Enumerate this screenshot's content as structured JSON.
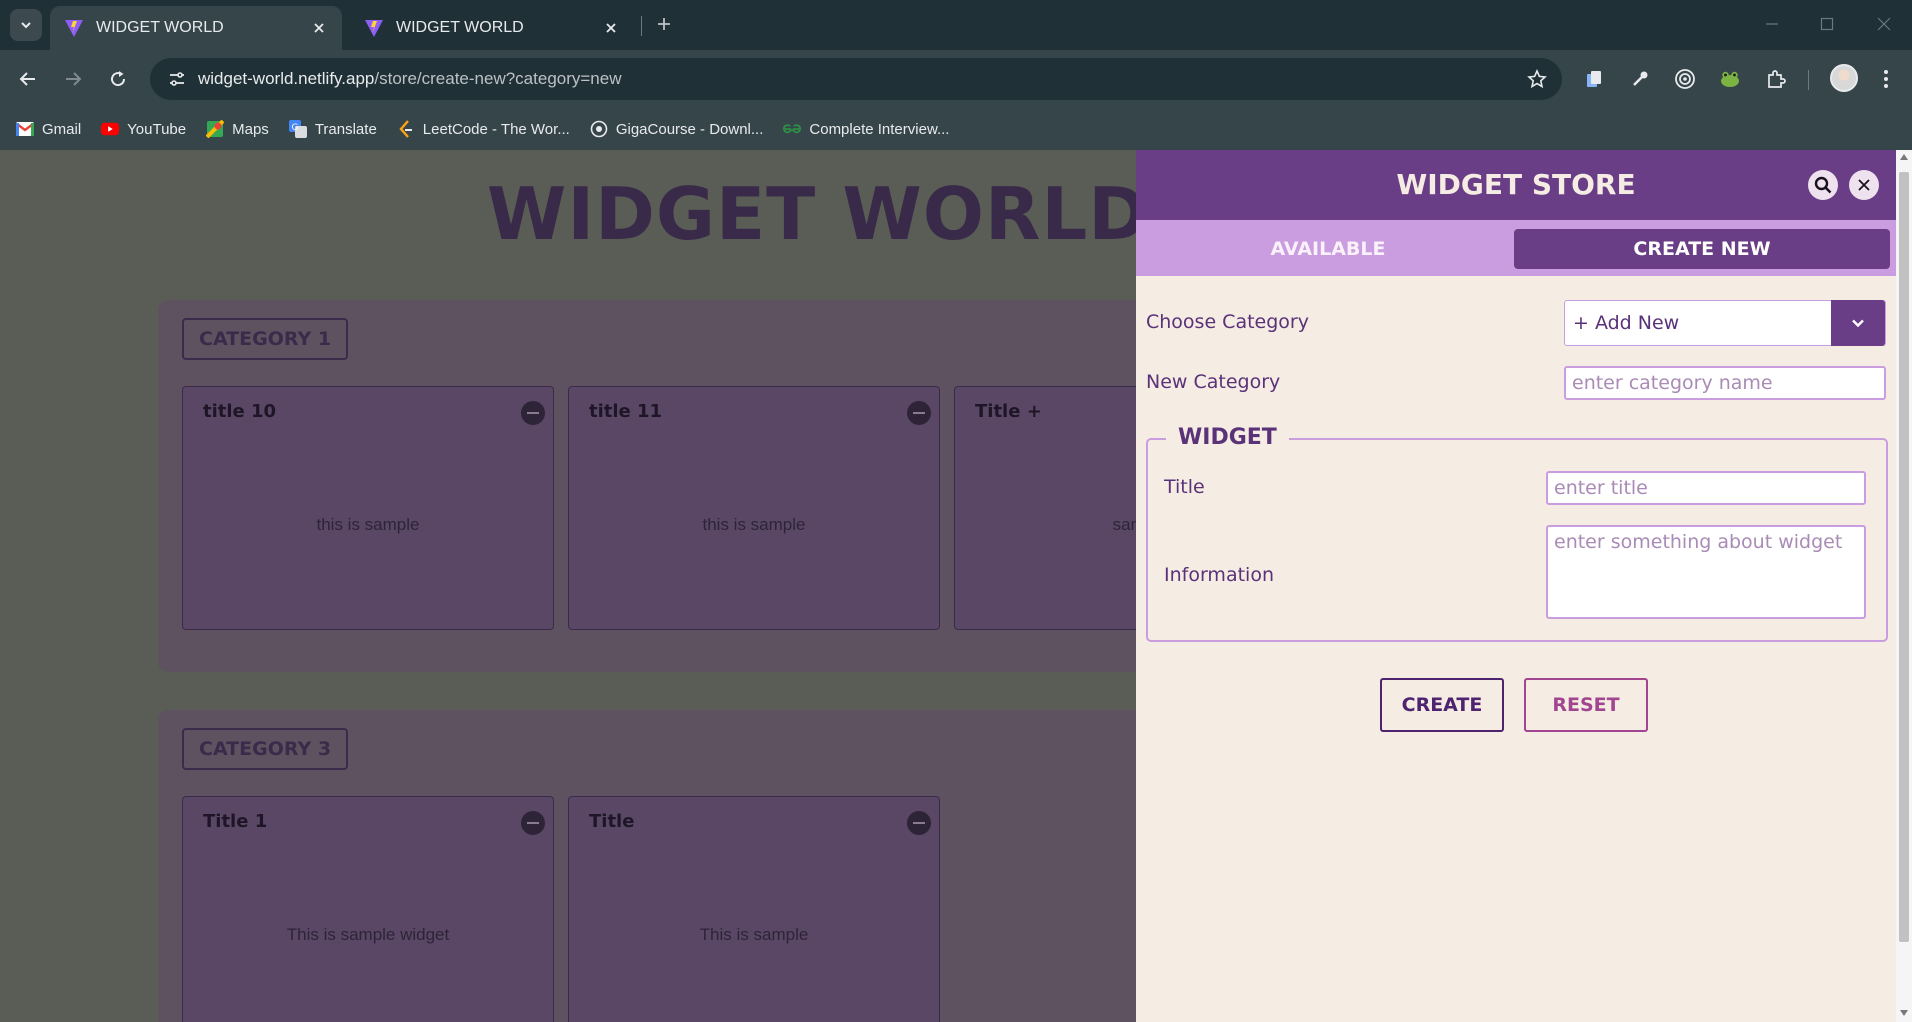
{
  "browser": {
    "tabs": [
      {
        "title": "WIDGET WORLD",
        "active": true,
        "icon": "vite-logo-icon"
      },
      {
        "title": "WIDGET WORLD",
        "active": false,
        "icon": "vite-logo-icon"
      }
    ],
    "url_host": "widget-world.netlify.app",
    "url_path": "/store/create-new?category=new",
    "bookmarks": [
      {
        "label": "Gmail",
        "icon": "gmail-icon"
      },
      {
        "label": "YouTube",
        "icon": "youtube-icon"
      },
      {
        "label": "Maps",
        "icon": "maps-icon"
      },
      {
        "label": "Translate",
        "icon": "translate-icon"
      },
      {
        "label": "LeetCode - The Wor...",
        "icon": "leetcode-icon"
      },
      {
        "label": "GigaCourse - Downl...",
        "icon": "gigacourse-icon"
      },
      {
        "label": "Complete Interview...",
        "icon": "gfg-icon"
      }
    ]
  },
  "page": {
    "title": "WIDGET WORLD",
    "categories": [
      {
        "name": "CATEGORY 1",
        "widgets": [
          {
            "title": "title 10",
            "info": "this is sample"
          },
          {
            "title": "title 11",
            "info": "this is sample"
          },
          {
            "title": "Title +",
            "info": "sample"
          }
        ]
      },
      {
        "name": "CATEGORY 3",
        "widgets": [
          {
            "title": "Title 1",
            "info": "This is sample widget"
          },
          {
            "title": "Title",
            "info": "This is sample"
          }
        ]
      }
    ]
  },
  "drawer": {
    "title": "WIDGET STORE",
    "tabs": {
      "available": "AVAILABLE",
      "create_new": "CREATE NEW"
    },
    "choose_category_label": "Choose Category",
    "choose_category_value": "+ Add New",
    "new_category_label": "New Category",
    "new_category_placeholder": "enter category name",
    "widget_legend": "WIDGET",
    "title_label": "Title",
    "title_placeholder": "enter title",
    "information_label": "Information",
    "information_placeholder": "enter something about widget",
    "create_label": "CREATE",
    "reset_label": "RESET"
  },
  "colors": {
    "brand_purple": "#6a3d87",
    "light_purple": "#c99ddf",
    "cream": "#f5ece4",
    "reset_magenta": "#a14590"
  }
}
